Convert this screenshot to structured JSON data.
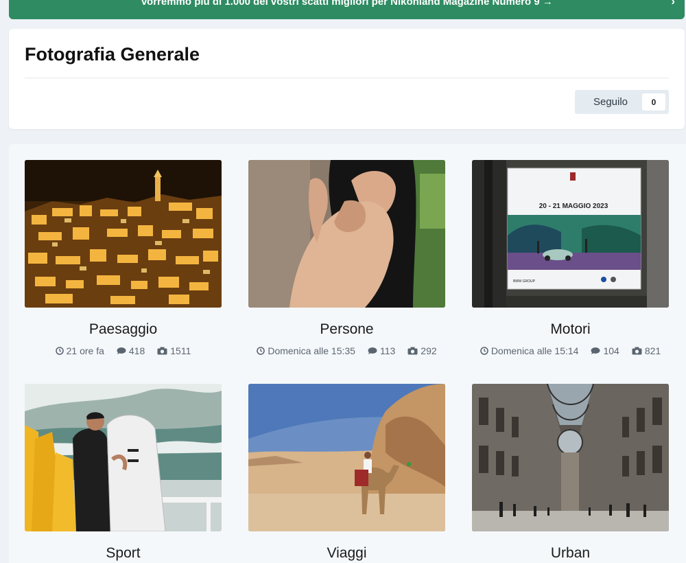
{
  "banner": {
    "text": "Vorremmo più di 1.000 dei vostri scatti migliori per Nikonland Magazine Numero 9 →",
    "chevron": "›"
  },
  "header": {
    "title": "Fotografia Generale",
    "follow_label": "Seguilo",
    "follow_count": "0"
  },
  "categories": [
    {
      "name": "Paesaggio",
      "time": "21 ore fa",
      "comments": "418",
      "photos": "1511"
    },
    {
      "name": "Persone",
      "time": "Domenica alle 15:35",
      "comments": "113",
      "photos": "292"
    },
    {
      "name": "Motori",
      "time": "Domenica alle 15:14",
      "comments": "104",
      "photos": "821"
    },
    {
      "name": "Sport"
    },
    {
      "name": "Viaggi"
    },
    {
      "name": "Urban"
    }
  ],
  "poster": {
    "date_text": "20 - 21 MAGGIO 2023",
    "logo_text": "BMW GROUP"
  },
  "icons": {
    "clock": "clock-icon",
    "comment": "comment-icon",
    "camera": "camera-icon"
  },
  "colors": {
    "banner": "#2e8b62",
    "follow_bg": "#e4ebf1"
  }
}
